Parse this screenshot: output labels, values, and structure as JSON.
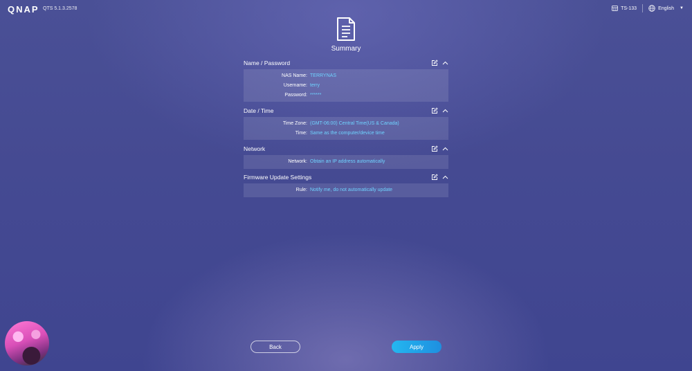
{
  "header": {
    "logo": "QNAP",
    "version": "QTS 5.1.3.2578",
    "model": "TS-133",
    "language": "English"
  },
  "summary": {
    "title": "Summary"
  },
  "sections": {
    "name_password": {
      "title": "Name / Password",
      "rows": [
        {
          "label": "NAS Name:",
          "value": "TERRYNAS"
        },
        {
          "label": "Username:",
          "value": "terry"
        },
        {
          "label": "Password:",
          "value": "******"
        }
      ]
    },
    "date_time": {
      "title": "Date / Time",
      "rows": [
        {
          "label": "Time Zone:",
          "value": "(GMT-06:00) Central Time(US & Canada)"
        },
        {
          "label": "Time:",
          "value": "Same as the computer/device time"
        }
      ]
    },
    "network": {
      "title": "Network",
      "rows": [
        {
          "label": "Network:",
          "value": "Obtain an IP address automatically"
        }
      ]
    },
    "firmware": {
      "title": "Firmware Update Settings",
      "rows": [
        {
          "label": "Rule:",
          "value": "Notify me, do not automatically update"
        }
      ]
    }
  },
  "buttons": {
    "back": "Back",
    "apply": "Apply"
  },
  "icons": {
    "edit": "edit-icon",
    "collapse": "chevron-up-icon",
    "summary": "document-list-icon",
    "device": "nas-device-icon",
    "globe": "globe-icon"
  },
  "colors": {
    "value": "#6fd3ff",
    "apply_start": "#24b7f0",
    "apply_end": "#1e8fe0"
  }
}
